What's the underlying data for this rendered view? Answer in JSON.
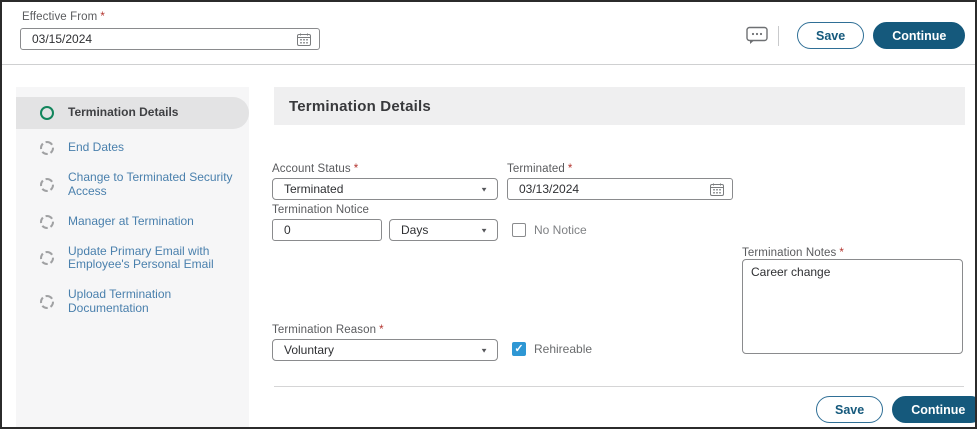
{
  "ui": {
    "required_marker": "*",
    "icons": {
      "chevron_down": "▼",
      "check": "✓"
    },
    "colors": {
      "accent": "#15597c",
      "checkbox_checked": "#2e97d4",
      "active_step_ring": "#12855c",
      "link": "#4a80ad",
      "required": "#b3352f"
    }
  },
  "top_bar": {
    "effective_from": {
      "label": "Effective From",
      "value": "03/15/2024"
    },
    "save_label": "Save",
    "continue_label": "Continue"
  },
  "stepper": {
    "items": [
      {
        "label": "Termination Details",
        "state": "active"
      },
      {
        "label": "End Dates",
        "state": "pending"
      },
      {
        "label": "Change to Terminated Security Access",
        "state": "pending"
      },
      {
        "label": "Manager at Termination",
        "state": "pending"
      },
      {
        "label": "Update Primary Email with Employee's Personal Email",
        "state": "pending"
      },
      {
        "label": "Upload Termination Documentation",
        "state": "pending"
      }
    ]
  },
  "main": {
    "title": "Termination Details",
    "fields": {
      "account_status": {
        "label": "Account Status",
        "required": true,
        "value": "Terminated"
      },
      "terminated": {
        "label": "Terminated",
        "required": true,
        "value": "03/13/2024"
      },
      "termination_notice": {
        "label": "Termination Notice",
        "value": "0",
        "unit": "Days"
      },
      "no_notice": {
        "label": "No Notice",
        "checked": false
      },
      "termination_notes": {
        "label": "Termination Notes",
        "required": true,
        "value": "Career change"
      },
      "termination_reason": {
        "label": "Termination Reason",
        "required": true,
        "value": "Voluntary"
      },
      "rehireable": {
        "label": "Rehireable",
        "checked": true
      }
    },
    "footer": {
      "save_label": "Save",
      "continue_label": "Continue"
    }
  }
}
